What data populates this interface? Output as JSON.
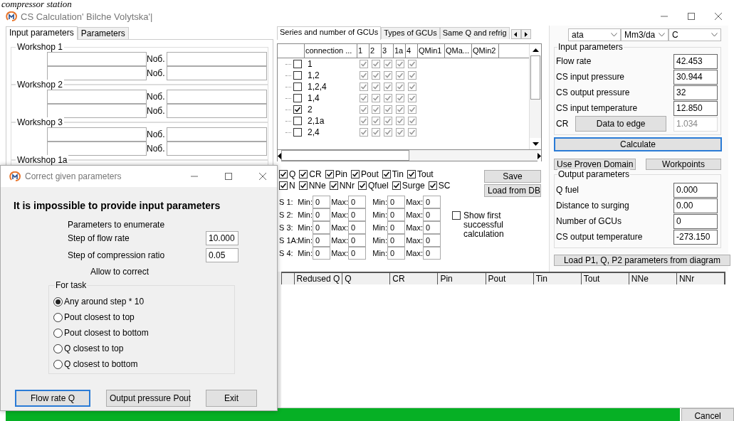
{
  "caption": "compressor station",
  "window": {
    "title": "CS Calculation' Bilche Volytska'|"
  },
  "left_tabs": [
    {
      "label": "Input parameters",
      "selected": true
    },
    {
      "label": "Parameters",
      "selected": false
    }
  ],
  "workshops": [
    {
      "title": "Workshop 1",
      "rows": [
        {
          "label": "Noб."
        },
        {
          "label": "Noб."
        }
      ]
    },
    {
      "title": "Workshop 2",
      "rows": [
        {
          "label": "Noб."
        },
        {
          "label": "Noб."
        }
      ]
    },
    {
      "title": "Workshop 3",
      "rows": [
        {
          "label": "Noб."
        },
        {
          "label": "Noб."
        }
      ]
    },
    {
      "title": "Workshop 1a"
    }
  ],
  "middle_tabs": [
    {
      "label": "Series and number of GCUs",
      "selected": true
    },
    {
      "label": "Types of GCUs",
      "selected": false
    },
    {
      "label": "Same Q and refrig",
      "selected": false
    }
  ],
  "grid": {
    "columns": [
      "connection ...",
      "1",
      "2",
      "3",
      "1a",
      "4",
      "QMin1",
      "QMa...",
      "QMin2"
    ],
    "rows": [
      {
        "connection": "1",
        "checked": false,
        "units": [
          true,
          true,
          true,
          true,
          true
        ]
      },
      {
        "connection": "1,2",
        "checked": false,
        "units": [
          true,
          true,
          true,
          true,
          true
        ]
      },
      {
        "connection": "1,2,4",
        "checked": false,
        "units": [
          true,
          true,
          true,
          true,
          true
        ]
      },
      {
        "connection": "1,4",
        "checked": false,
        "units": [
          true,
          true,
          true,
          true,
          true
        ]
      },
      {
        "connection": "2",
        "checked": true,
        "units": [
          true,
          true,
          true,
          true,
          true
        ]
      },
      {
        "connection": "2,1a",
        "checked": false,
        "units": [
          true,
          true,
          true,
          true,
          true
        ]
      },
      {
        "connection": "2,4",
        "checked": false,
        "units": [
          true,
          true,
          true,
          true,
          true
        ]
      }
    ]
  },
  "field_checks": [
    [
      {
        "label": "Q",
        "checked": true
      },
      {
        "label": "CR",
        "checked": true
      },
      {
        "label": "Pin",
        "checked": true
      },
      {
        "label": "Pout",
        "checked": true
      },
      {
        "label": "Tin",
        "checked": true
      },
      {
        "label": "Tout",
        "checked": true
      }
    ],
    [
      {
        "label": "N",
        "checked": true
      },
      {
        "label": "NNe",
        "checked": true
      },
      {
        "label": "NNr",
        "checked": true
      },
      {
        "label": "Qfuel",
        "checked": true
      },
      {
        "label": "Surge",
        "checked": true
      },
      {
        "label": "SC",
        "checked": true
      }
    ]
  ],
  "save_button": "Save",
  "load_db_button": "Load from DB",
  "ranges": [
    {
      "label": "S 1:",
      "cells": [
        {
          "label": "Min:",
          "value": "0"
        },
        {
          "label": "Max:",
          "value": "0"
        },
        {
          "label": "Min:",
          "value": "0"
        },
        {
          "label": "Max:",
          "value": "0"
        }
      ]
    },
    {
      "label": "S 2:",
      "cells": [
        {
          "label": "Min:",
          "value": "0"
        },
        {
          "label": "Max:",
          "value": "0"
        },
        {
          "label": "Min:",
          "value": "0"
        },
        {
          "label": "Max:",
          "value": "0"
        }
      ]
    },
    {
      "label": "S 3:",
      "cells": [
        {
          "label": "Min:",
          "value": "0"
        },
        {
          "label": "Max:",
          "value": "0"
        },
        {
          "label": "Min:",
          "value": "0"
        },
        {
          "label": "Max:",
          "value": "0"
        }
      ]
    },
    {
      "label": "S 1A:",
      "cells": [
        {
          "label": "Min:",
          "value": "0"
        },
        {
          "label": "Max:",
          "value": "0"
        },
        {
          "label": "Min:",
          "value": "0"
        },
        {
          "label": "Max:",
          "value": "0"
        }
      ]
    },
    {
      "label": "S 4:",
      "cells": [
        {
          "label": "Min:",
          "value": "0"
        },
        {
          "label": "Max:",
          "value": "0"
        },
        {
          "label": "Min:",
          "value": "0"
        },
        {
          "label": "Max:",
          "value": "0"
        }
      ]
    }
  ],
  "show_first": {
    "label": "Show first successful calculation",
    "checked": false
  },
  "units": [
    "ata",
    "Mm3/da",
    "C"
  ],
  "input_parameters": {
    "title": "Input parameters",
    "rows": [
      {
        "label": "Flow rate",
        "value": "42.453"
      },
      {
        "label": "CS input pressure",
        "value": "30.944"
      },
      {
        "label": "CS output pressure",
        "value": "32"
      },
      {
        "label": "CS input temperature",
        "value": "12.850"
      }
    ],
    "cr": {
      "label": "CR",
      "button": "Data to edge",
      "value": "1.034",
      "disabled": true
    }
  },
  "calculate": {
    "label": "Calculate",
    "focused": true
  },
  "proven_button": "Use Proven Domain",
  "workpoints_button": "Workpoints",
  "output_parameters": {
    "title": "Output parameters",
    "rows": [
      {
        "label": "Q fuel",
        "value": "0.000"
      },
      {
        "label": "Distance to surging",
        "value": "0.00"
      },
      {
        "label": "Number of GCUs",
        "value": "0"
      },
      {
        "label": "CS output temperature",
        "value": "-273.150"
      }
    ]
  },
  "load_diagram_button": "Load P1, Q, P2 parameters from diagram",
  "table": {
    "columns": [
      "Redused Q",
      "Q",
      "CR",
      "Pin",
      "Pout",
      "Tin",
      "Tout",
      "NNe",
      "NNr"
    ]
  },
  "progress": {
    "level": 1
  },
  "cancel_button": "Cancel",
  "dialog": {
    "title": "Correct given parameters",
    "heading": "It is impossible to provide input parameters",
    "subheading": "Parameters to enumerate",
    "steps": [
      {
        "label": "Step of flow rate",
        "value": "10.000"
      },
      {
        "label": "Step of compression ratio",
        "value": "0.05"
      }
    ],
    "allow": "Allow to correct",
    "group": "For task",
    "options": [
      {
        "label": "Any around step * 10",
        "selected": true
      },
      {
        "label": "Pout closest to top",
        "selected": false
      },
      {
        "label": "Pout closest to bottom",
        "selected": false
      },
      {
        "label": "Q closest to top",
        "selected": false
      },
      {
        "label": "Q closest to bottom",
        "selected": false
      }
    ],
    "buttons": [
      {
        "label": "Flow rate Q",
        "focused": true
      },
      {
        "label": "Output pressure Pout",
        "focused": false
      },
      {
        "label": "Exit",
        "focused": false
      }
    ]
  }
}
